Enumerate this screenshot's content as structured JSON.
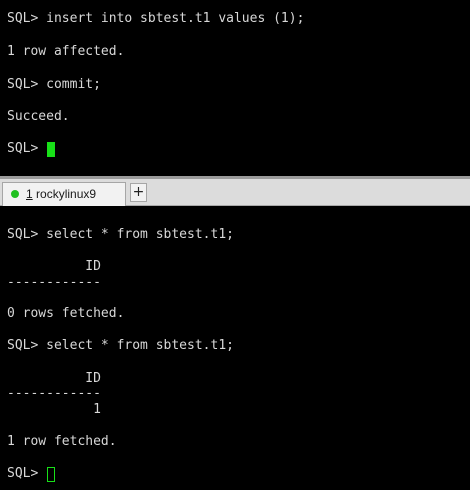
{
  "top_session": {
    "lines": [
      "SQL> insert into sbtest.t1 values (1);",
      "1 row affected.",
      "SQL> commit;",
      "Succeed.",
      "SQL> "
    ]
  },
  "tabs": [
    {
      "number": "1",
      "title": " rockylinux9",
      "status_color": "#20c020"
    }
  ],
  "new_tab_label": "+",
  "bottom_session": {
    "lines": [
      "SQL> select * from sbtest.t1;",
      "          ID",
      "------------",
      "0 rows fetched.",
      "SQL> select * from sbtest.t1;",
      "          ID",
      "------------",
      "           1",
      "1 row fetched.",
      "SQL> "
    ]
  },
  "colors": {
    "terminal_bg": "#000000",
    "terminal_fg": "#d8d8d8",
    "cursor": "#18e018",
    "tabbar_bg": "#dcdcdc"
  }
}
